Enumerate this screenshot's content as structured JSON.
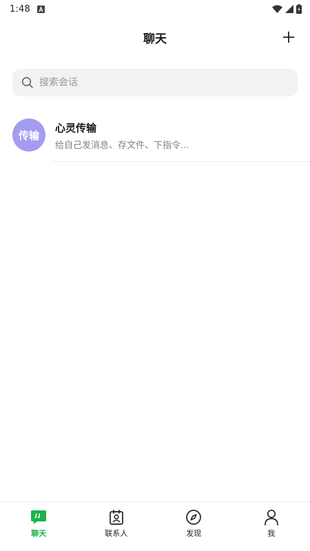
{
  "status_bar": {
    "time": "1:48",
    "icons": [
      "notification-a-icon",
      "wifi-icon",
      "signal-icon",
      "battery-charging-icon"
    ]
  },
  "header": {
    "title": "聊天",
    "add_icon": "plus-icon"
  },
  "search": {
    "placeholder": "搜索会话",
    "value": "",
    "icon": "search-icon"
  },
  "conversations": [
    {
      "avatar_text": "传输",
      "avatar_color": "#a49cf1",
      "name": "心灵传输",
      "preview": "给自己发消息、存文件、下指令..."
    }
  ],
  "tabs": [
    {
      "label": "聊天",
      "icon": "chat-bubble-icon",
      "active": true
    },
    {
      "label": "联系人",
      "icon": "contacts-icon",
      "active": false
    },
    {
      "label": "发现",
      "icon": "compass-icon",
      "active": false
    },
    {
      "label": "我",
      "icon": "person-icon",
      "active": false
    }
  ],
  "colors": {
    "accent": "#19b34c",
    "search_bg": "#f2f2f2",
    "avatar_bg": "#a49cf1",
    "text_secondary": "#808080"
  }
}
